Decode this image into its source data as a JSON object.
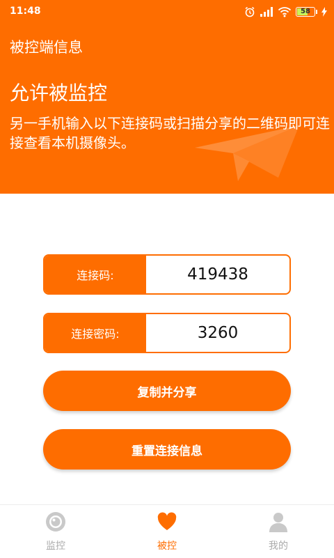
{
  "status_bar": {
    "time": "11:48",
    "battery_level": "58",
    "icons": [
      "alarm-icon",
      "signal-icon",
      "wifi-icon",
      "battery-icon",
      "charging-icon"
    ]
  },
  "header": {
    "app_title": "被控端信息",
    "main_title": "允许被监控",
    "description": "另一手机输入以下连接码或扫描分享的二维码即可连接查看本机摄像头。",
    "decoration_icon": "paper-plane-icon"
  },
  "connection": {
    "code_label": "连接码:",
    "code_value": "419438",
    "password_label": "连接密码:",
    "password_value": "3260"
  },
  "buttons": {
    "copy_share": "复制并分享",
    "reset": "重置连接信息"
  },
  "bottom_nav": {
    "items": [
      {
        "label": "监控",
        "icon": "camera-icon",
        "active": false
      },
      {
        "label": "被控",
        "icon": "heart-icon",
        "active": true
      },
      {
        "label": "我的",
        "icon": "person-icon",
        "active": false
      }
    ]
  },
  "colors": {
    "accent": "#fe6d00",
    "inactive": "#aaaaaa",
    "battery_fill": "#c8f35a"
  }
}
